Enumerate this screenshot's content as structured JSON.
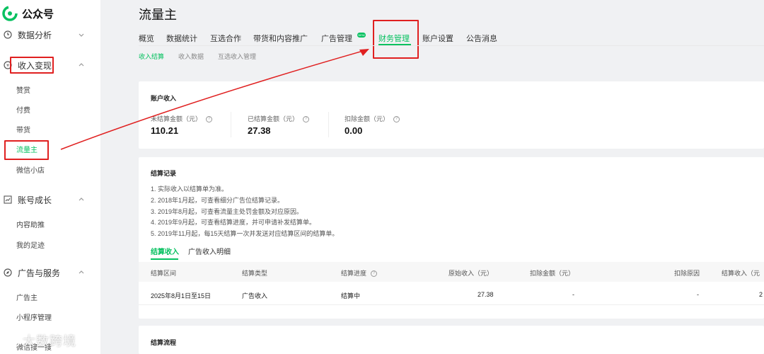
{
  "app": {
    "name": "公众号",
    "accent": "#07c160",
    "highlight": "#e02020"
  },
  "sidebar": {
    "groups": [
      {
        "label": "数据分析",
        "icon": "clock-icon"
      },
      {
        "label": "收入变现",
        "icon": "coin-icon"
      },
      {
        "label": "账号成长",
        "icon": "trend-icon"
      },
      {
        "label": "广告与服务",
        "icon": "compass-icon"
      }
    ],
    "items": {
      "income": [
        "赞赏",
        "付费",
        "带货",
        "流量主",
        "微信小店"
      ],
      "growth": [
        "内容助推",
        "我的足迹"
      ],
      "ads": [
        "广告主",
        "小程序管理",
        "微信搜一搜"
      ]
    },
    "active_item": "流量主"
  },
  "page": {
    "title": "流量主"
  },
  "tabs": [
    "概览",
    "数据统计",
    "互选合作",
    "带货和内容推广",
    "广告管理",
    "财务管理",
    "账户设置",
    "公告消息"
  ],
  "active_tab": "财务管理",
  "new_badge": "NEW",
  "subtabs": [
    "收入结算",
    "收入数据",
    "互选收入管理"
  ],
  "account": {
    "title": "账户收入",
    "stats": [
      {
        "label": "未结算金额（元）",
        "value": "110.21"
      },
      {
        "label": "已结算金额（元）",
        "value": "27.38"
      },
      {
        "label": "扣除金额（元）",
        "value": "0.00"
      }
    ]
  },
  "records": {
    "title": "结算记录",
    "notes": [
      "1. 实际收入以结算单为准。",
      "2. 2018年1月起，可查看细分广告位结算记录。",
      "3. 2019年8月起，可查看流量主处罚金额及对应原因。",
      "4. 2019年9月起，可查看结算进度，并可申请补发结算单。",
      "5. 2019年11月起，每15天结算一次并发送对应结算区间的结算单。"
    ],
    "tabs": [
      "结算收入",
      "广告收入明细"
    ],
    "columns": [
      "结算区间",
      "结算类型",
      "结算进度",
      "原始收入（元）",
      "扣除金额（元）",
      "扣除原因",
      "结算收入（元"
    ],
    "rows": [
      {
        "period": "2025年8月1日至15日",
        "type": "广告收入",
        "progress": "结算中",
        "original": "27.38",
        "deduct": "-",
        "reason": "-",
        "settled": "2"
      }
    ]
  },
  "flow": {
    "title": "结算流程"
  },
  "watermark": "大数跨境"
}
